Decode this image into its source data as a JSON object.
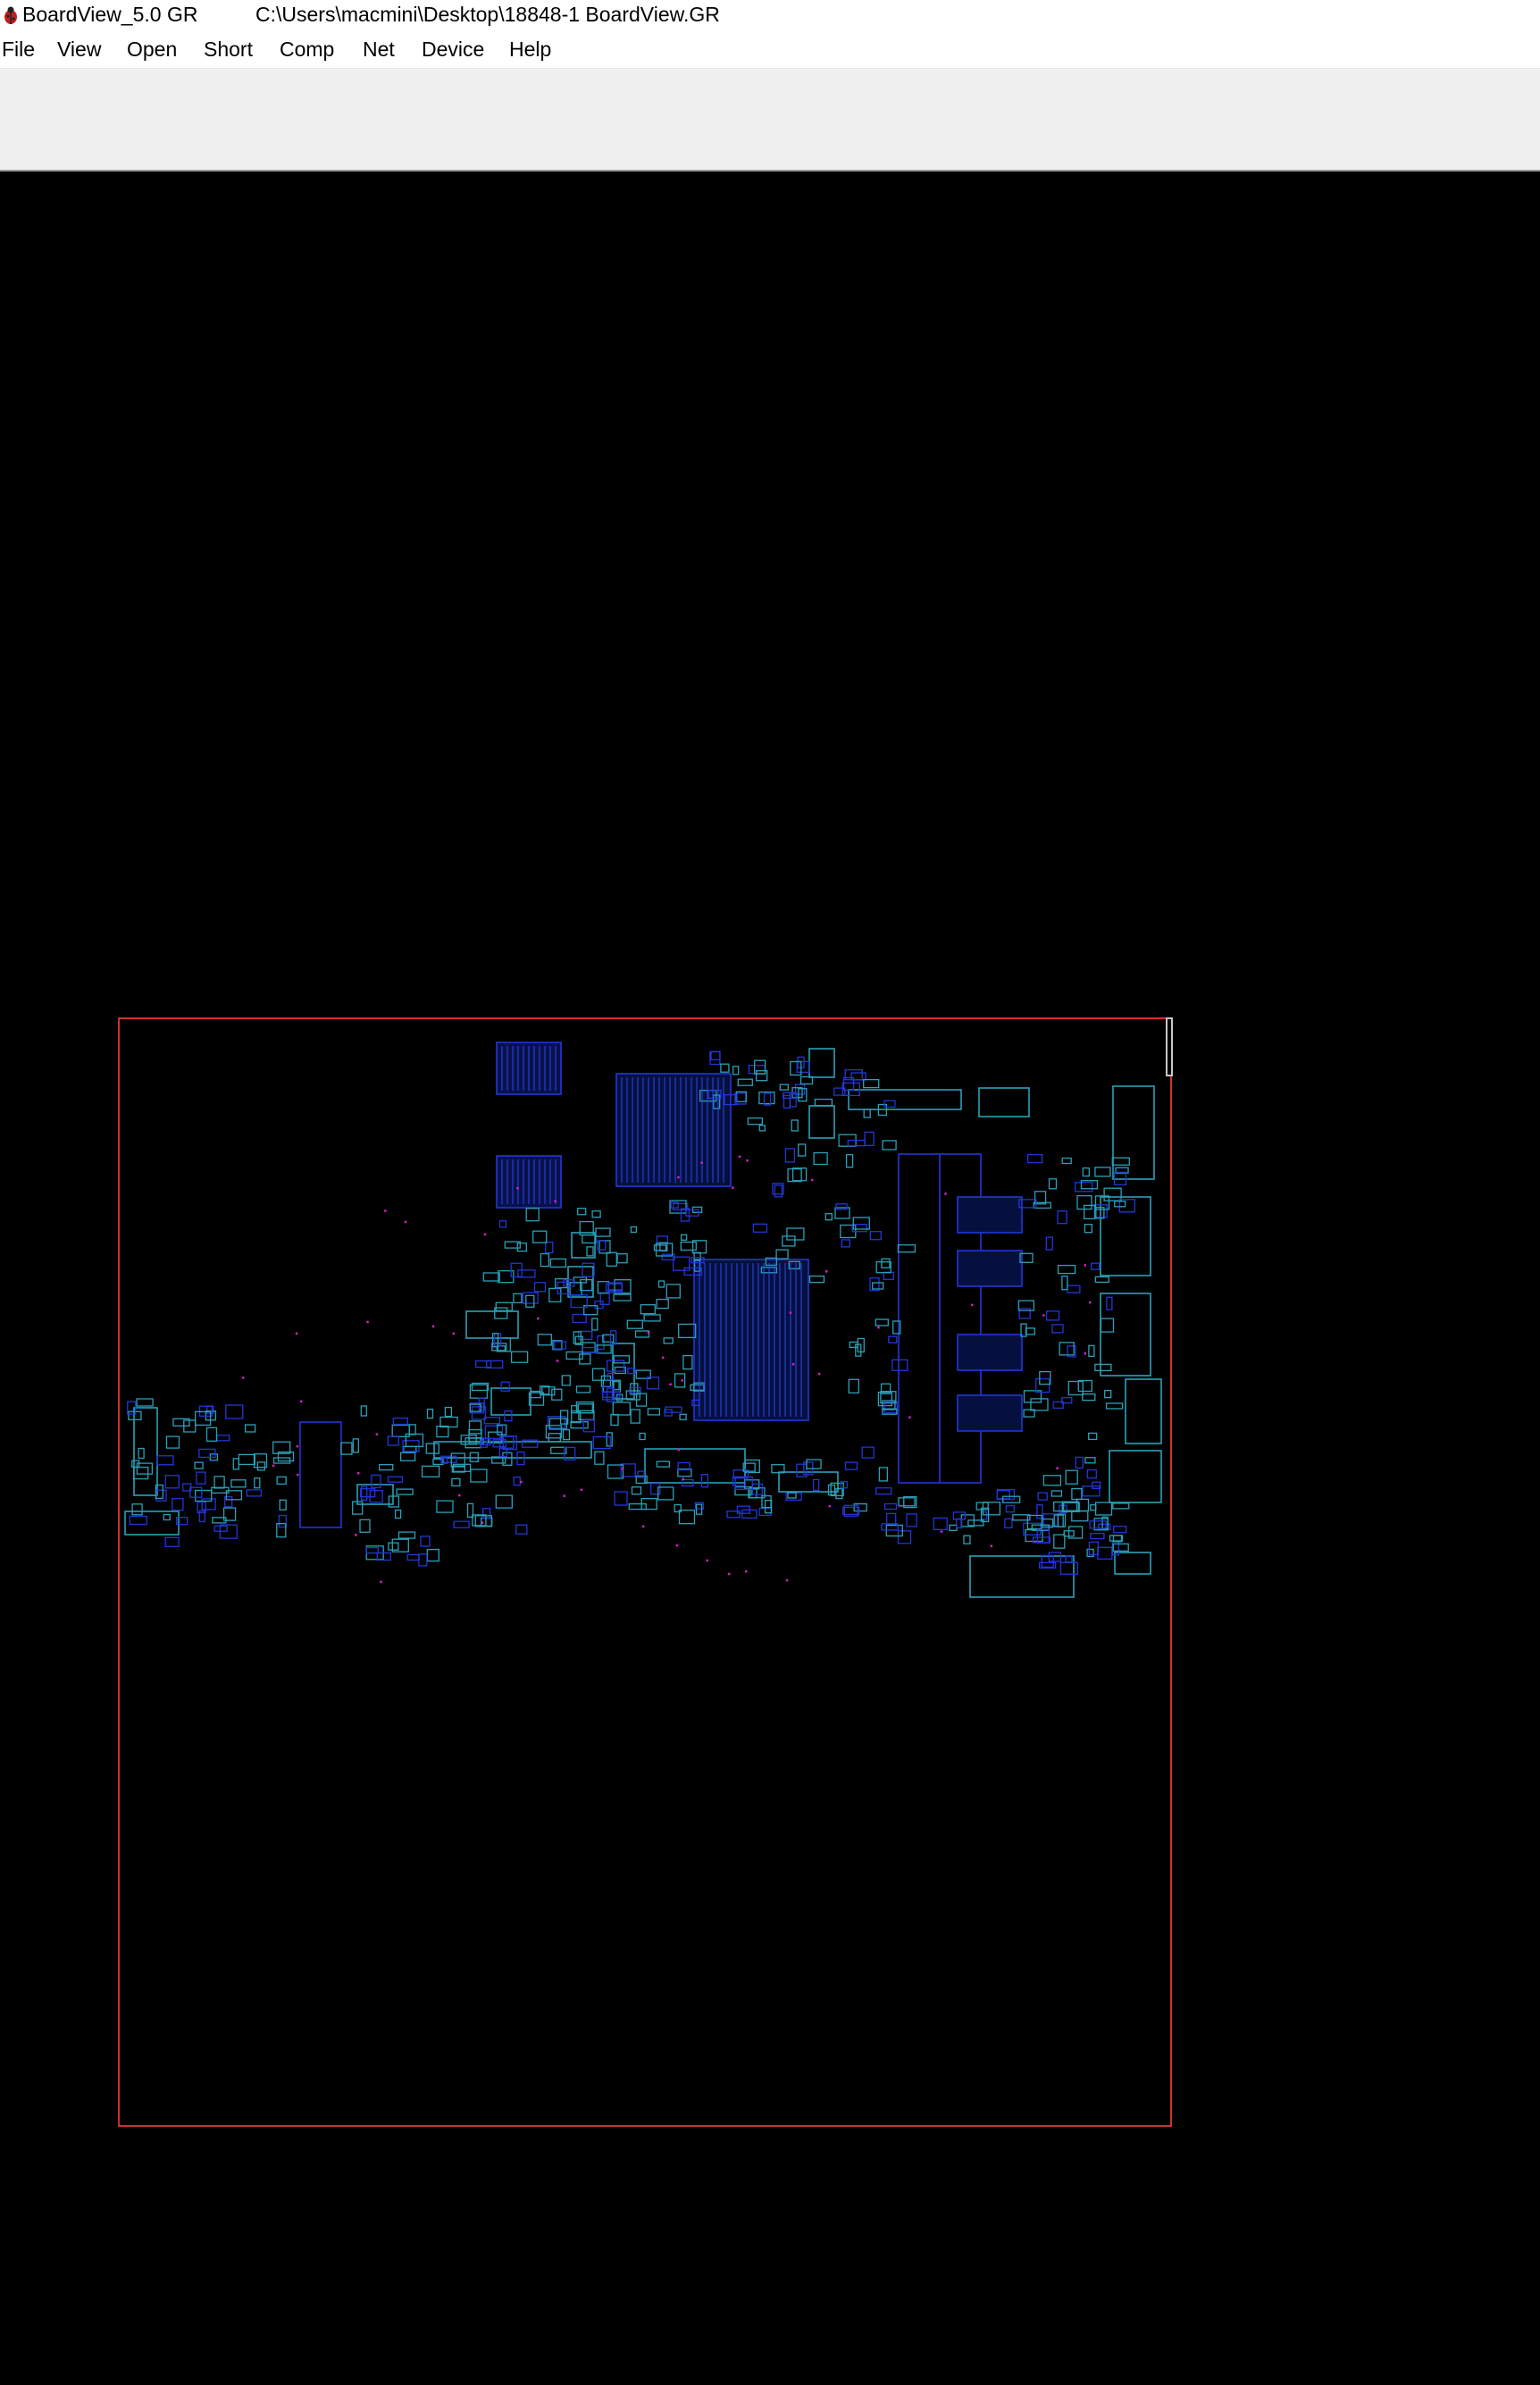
{
  "window": {
    "app_title": "BoardView_5.0 GR",
    "file_path": "C:\\Users\\macmini\\Desktop\\18848-1 BoardView.GR",
    "app_icon": "beetle-icon"
  },
  "menu": {
    "file": "File",
    "view": "View",
    "open": "Open",
    "short": "Short",
    "comp": "Comp",
    "net": "Net",
    "device": "Device",
    "help": "Help"
  },
  "colors": {
    "outline": "#d0302a",
    "component": "#2aa0b8",
    "chip": "#2236d8",
    "pin_marker": "#d020c8",
    "background": "#000000",
    "toolbar": "#f0f0f0"
  }
}
